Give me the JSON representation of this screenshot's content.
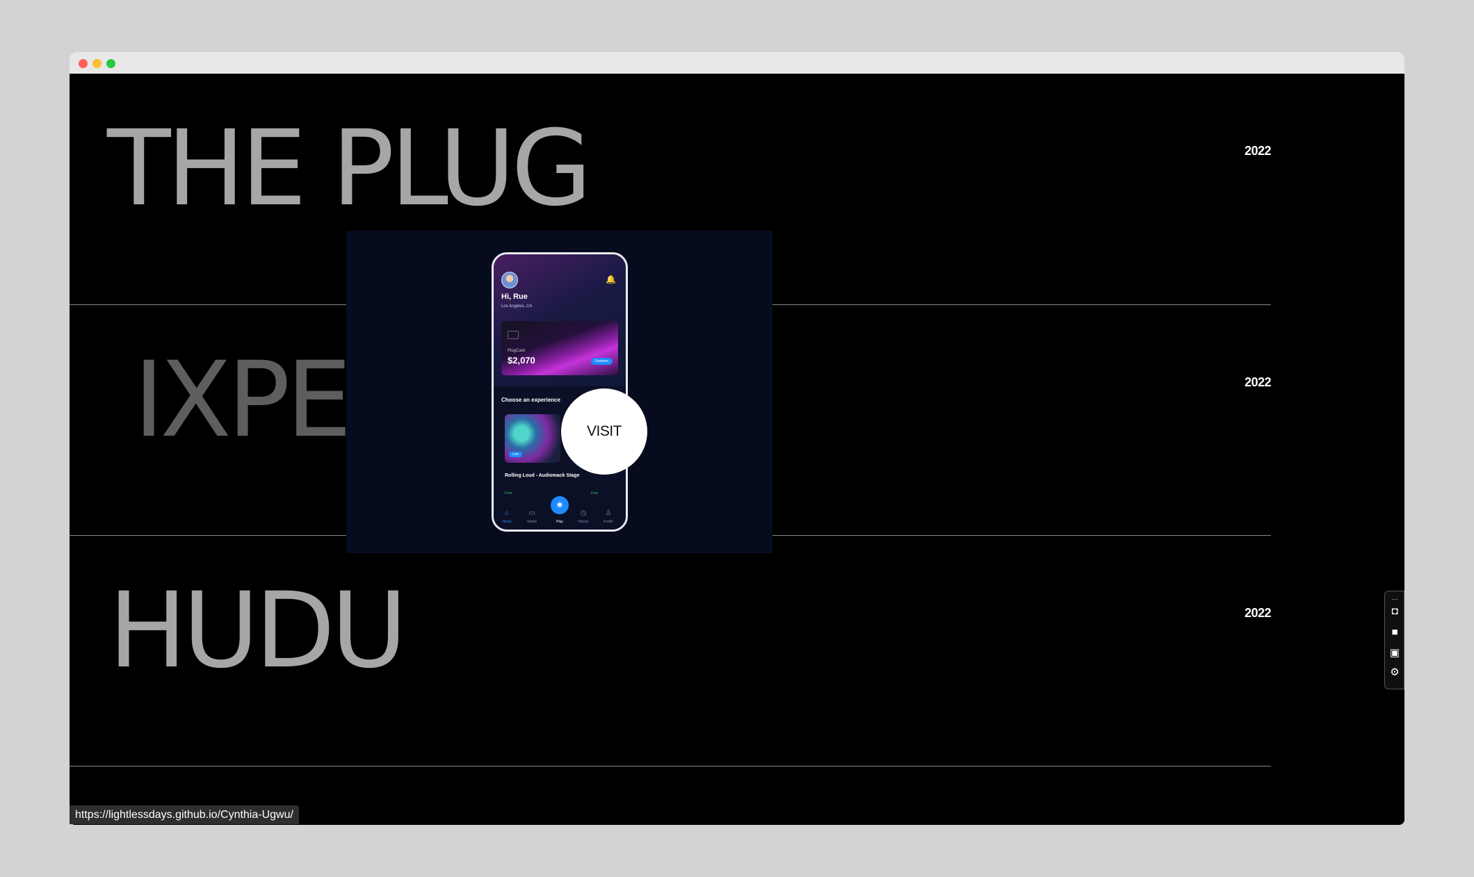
{
  "browser": {
    "status_url": "https://lightlessdays.github.io/Cynthia-Ugwu/"
  },
  "projects": [
    {
      "title": "THE PLUG",
      "year": "2022",
      "color": "#a6a6a6"
    },
    {
      "title": "IXPE",
      "year": "2022",
      "color": "#5e5e5e"
    },
    {
      "title": "HUDU",
      "year": "2022",
      "color": "#a6a6a6"
    }
  ],
  "preview": {
    "greeting": "Hi, Rue",
    "location": "Los Angeles, CA",
    "card_label": "PlugCard",
    "amount": "$2,070",
    "redeem": "Redeem",
    "choose_title": "Choose an experience",
    "experience_pill": "Live",
    "experience_name": "Rolling Loud - Audiomack Stage",
    "experience_price": "Free",
    "experience_price_2": "Free",
    "tabs": [
      "Home",
      "Wallet",
      "Play",
      "History",
      "Profile"
    ]
  },
  "visit_label": "VISIT",
  "tools": [
    "camera-icon",
    "video-icon",
    "window-icon",
    "gear-icon"
  ]
}
